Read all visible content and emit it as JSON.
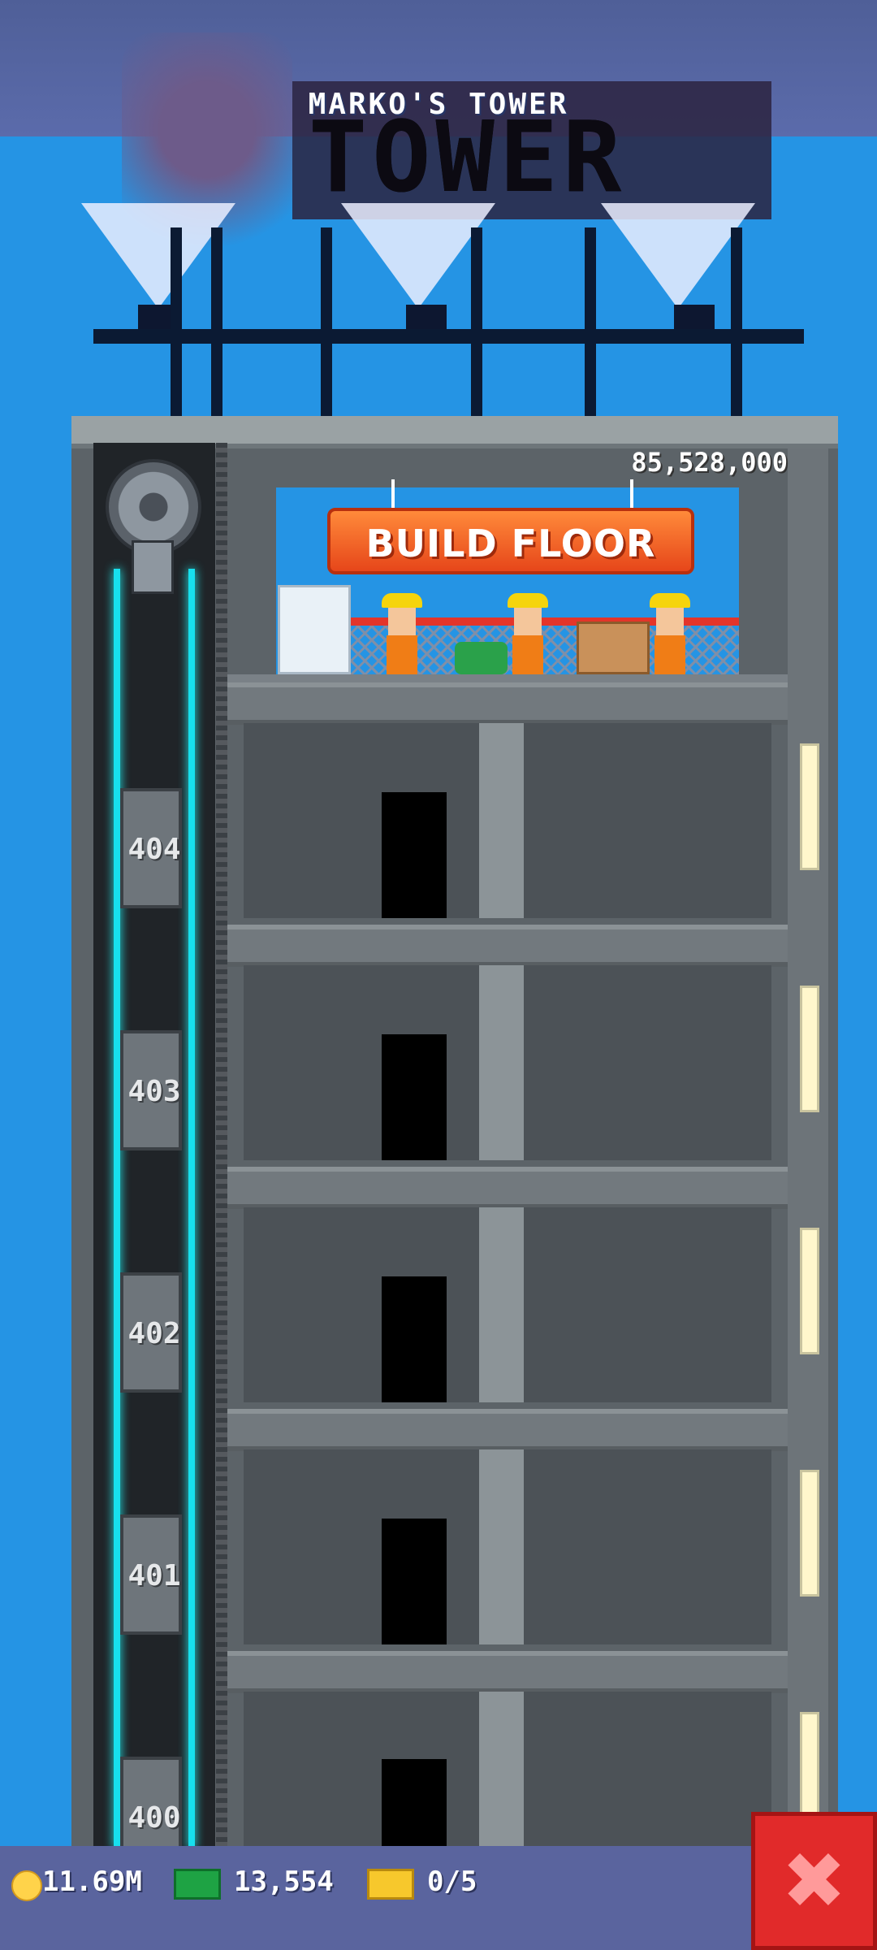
{
  "header": {
    "title": "MARKO'S TOWER"
  },
  "sign": {
    "text": "TOWER"
  },
  "tower": {
    "balance": "85,528,000",
    "build_button_label": "BUILD FLOOR",
    "floors": [
      {
        "label": "404"
      },
      {
        "label": "403"
      },
      {
        "label": "402"
      },
      {
        "label": "401"
      },
      {
        "label": "400"
      }
    ]
  },
  "status": {
    "coins": "11.69M",
    "bux": "13,554",
    "tickets": "0/5"
  },
  "icons": {
    "coin": "coin-icon",
    "bux": "bux-icon",
    "tickets": "ticket-icon",
    "close": "close-icon"
  },
  "colors": {
    "sky": "#2594e4",
    "header": "#5a649e",
    "build_button": "#f2662a",
    "close_button": "#e12a2a",
    "elevator_rail": "#17e0ee"
  }
}
